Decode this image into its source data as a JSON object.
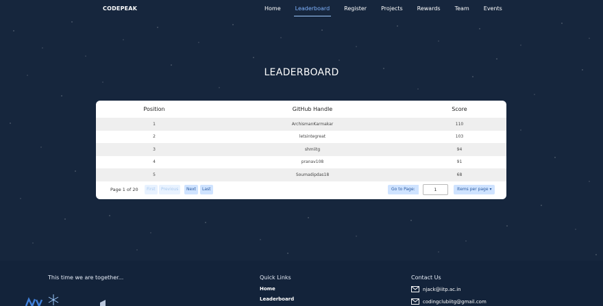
{
  "nav": {
    "brand": "CODEPEAK",
    "links": [
      {
        "label": "Home",
        "active": false
      },
      {
        "label": "Leaderboard",
        "active": true
      },
      {
        "label": "Register",
        "active": false
      },
      {
        "label": "Projects",
        "active": false
      },
      {
        "label": "Rewards",
        "active": false
      },
      {
        "label": "Team",
        "active": false
      },
      {
        "label": "Events",
        "active": false
      }
    ]
  },
  "page": {
    "title": "LEADERBOARD"
  },
  "table": {
    "headers": {
      "position": "Position",
      "handle": "GitHub Handle",
      "score": "Score"
    },
    "rows": [
      {
        "position": "1",
        "handle": "ArchismanKarmakar",
        "score": "110"
      },
      {
        "position": "2",
        "handle": "letsintegreat",
        "score": "103"
      },
      {
        "position": "3",
        "handle": "shmiitg",
        "score": "94"
      },
      {
        "position": "4",
        "handle": "pranav108",
        "score": "91"
      },
      {
        "position": "5",
        "handle": "Soumadipdas18",
        "score": "68"
      }
    ]
  },
  "pager": {
    "info": "Page 1 of 20",
    "first": "First",
    "previous": "Previous",
    "next": "Next",
    "last": "Last",
    "goto_label": "Go to Page:",
    "goto_value": "1",
    "items_per_page": "Items per page ▾"
  },
  "footer": {
    "tagline": "This time we are together...",
    "quick_links_title": "Quick Links",
    "quick_links": [
      "Home",
      "Leaderboard"
    ],
    "contact_title": "Contact Us",
    "emails": [
      "njack@iitp.ac.in",
      "codingclubiitg@gmail.com"
    ]
  },
  "colors": {
    "background": "#16263d",
    "accent": "#7fb3ff",
    "button": "#cfe3ff"
  }
}
